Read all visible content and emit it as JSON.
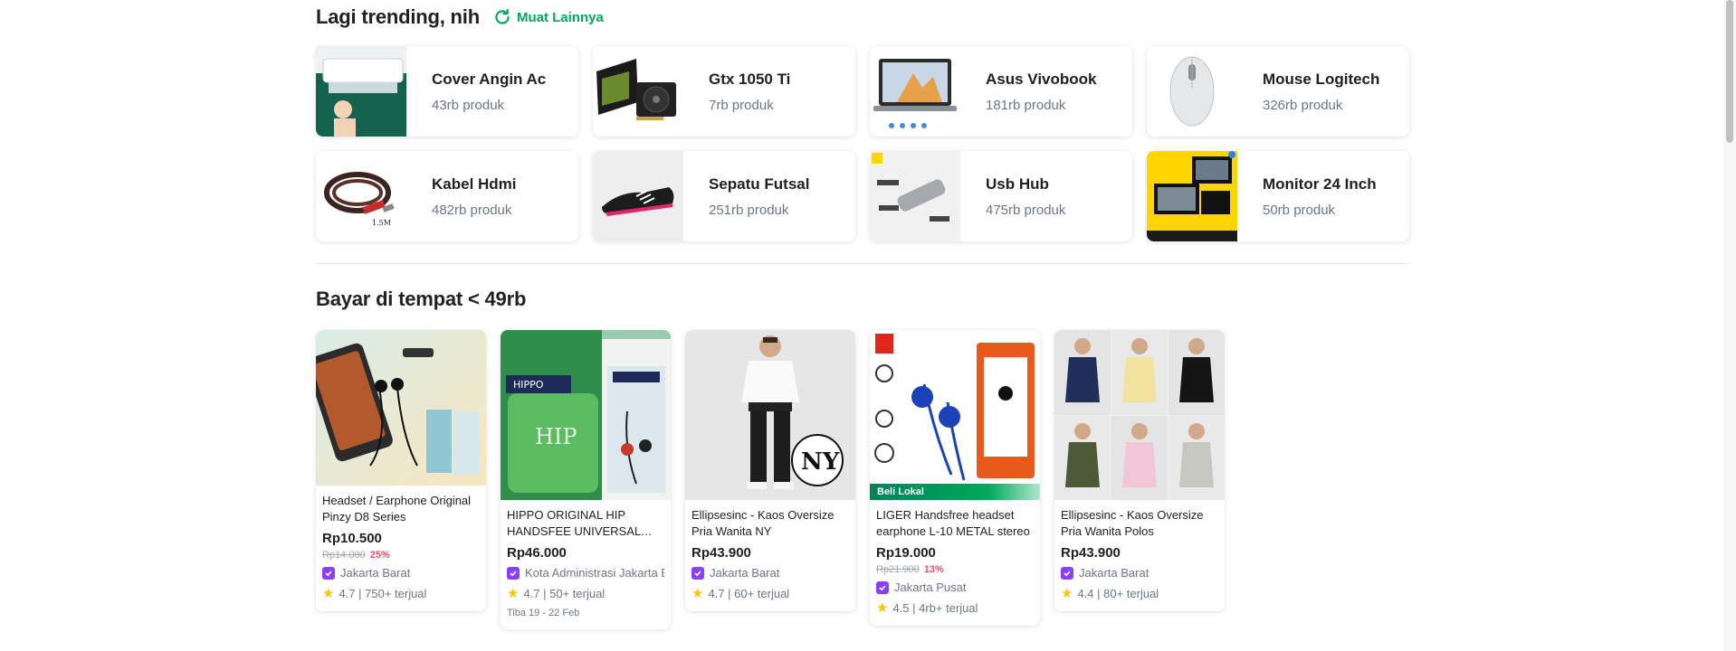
{
  "trending": {
    "title": "Lagi trending, nih",
    "reload_label": "Muat Lainnya",
    "items": [
      {
        "name": "Cover Angin Ac",
        "count": "43rb produk"
      },
      {
        "name": "Gtx 1050 Ti",
        "count": "7rb produk"
      },
      {
        "name": "Asus Vivobook",
        "count": "181rb produk"
      },
      {
        "name": "Mouse Logitech",
        "count": "326rb produk"
      },
      {
        "name": "Kabel Hdmi",
        "count": "482rb produk"
      },
      {
        "name": "Sepatu Futsal",
        "count": "251rb produk"
      },
      {
        "name": "Usb Hub",
        "count": "475rb produk"
      },
      {
        "name": "Monitor 24 Inch",
        "count": "50rb produk"
      }
    ]
  },
  "cod": {
    "title": "Bayar di tempat < 49rb",
    "products": [
      {
        "name": "Headset / Earphone Original Pinzy D8 Series",
        "price": "Rp10.500",
        "old_price": "Rp14.000",
        "discount": "25%",
        "location": "Jakarta Barat",
        "rating": "4.7 | 750+ terjual"
      },
      {
        "name": "HIPPO ORIGINAL HIP HANDSFEE UNIVERSAL BASS",
        "price": "Rp46.000",
        "location": "Kota Administrasi Jakarta Barat",
        "rating": "4.7 | 50+ terjual",
        "eta": "Tiba 19 - 22 Feb"
      },
      {
        "name": "Ellipsesinc - Kaos Oversize Pria Wanita NY",
        "price": "Rp43.900",
        "location": "Jakarta Barat",
        "rating": "4.7 | 60+ terjual"
      },
      {
        "name": "LIGER Handsfree headset earphone L-10 METAL stereo",
        "price": "Rp19.000",
        "old_price": "Rp21.900",
        "discount": "13%",
        "location": "Jakarta Pusat",
        "rating": "4.5 | 4rb+ terjual",
        "tag": "Beli Lokal"
      },
      {
        "name": "Ellipsesinc - Kaos Oversize Pria Wanita Polos",
        "price": "Rp43.900",
        "location": "Jakarta Barat",
        "rating": "4.4 | 80+ terjual"
      }
    ]
  },
  "colors": {
    "accent": "#00aa5b",
    "discount": "#f94d63",
    "official_badge": "#8a3ffc",
    "star": "#ffc400"
  },
  "icons": [
    "reload-icon",
    "official-store-badge-icon",
    "star-icon"
  ]
}
